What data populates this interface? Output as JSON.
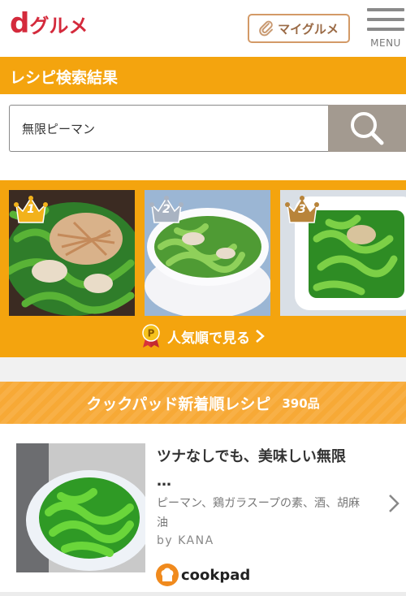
{
  "header": {
    "logo_d": "d",
    "logo_text": "グルメ",
    "my_button": "マイグルメ",
    "menu_label": "MENU"
  },
  "page_title": "レシピ検索結果",
  "search": {
    "value": "無限ピーマン"
  },
  "ranking": {
    "items": [
      {
        "rank": "1",
        "crown_color": "#f2b21b"
      },
      {
        "rank": "2",
        "crown_color": "#a9b3c2"
      },
      {
        "rank": "3",
        "crown_color": "#b8843a"
      }
    ],
    "popular_link": "人気順で見る"
  },
  "cookpad_section": {
    "title": "クックパッド新着順レシピ",
    "count": "390品"
  },
  "recipe": {
    "title_line1": "ツナなしでも、美味しい無限",
    "title_line2": "…",
    "ingredients": "ピーマン、鶏ガラスープの素、酒、胡麻油",
    "author": "by KANA",
    "source": "cookpad"
  },
  "colors": {
    "brand_red": "#d42a3c",
    "accent_orange": "#f4a40e",
    "search_button": "#a39a90"
  }
}
